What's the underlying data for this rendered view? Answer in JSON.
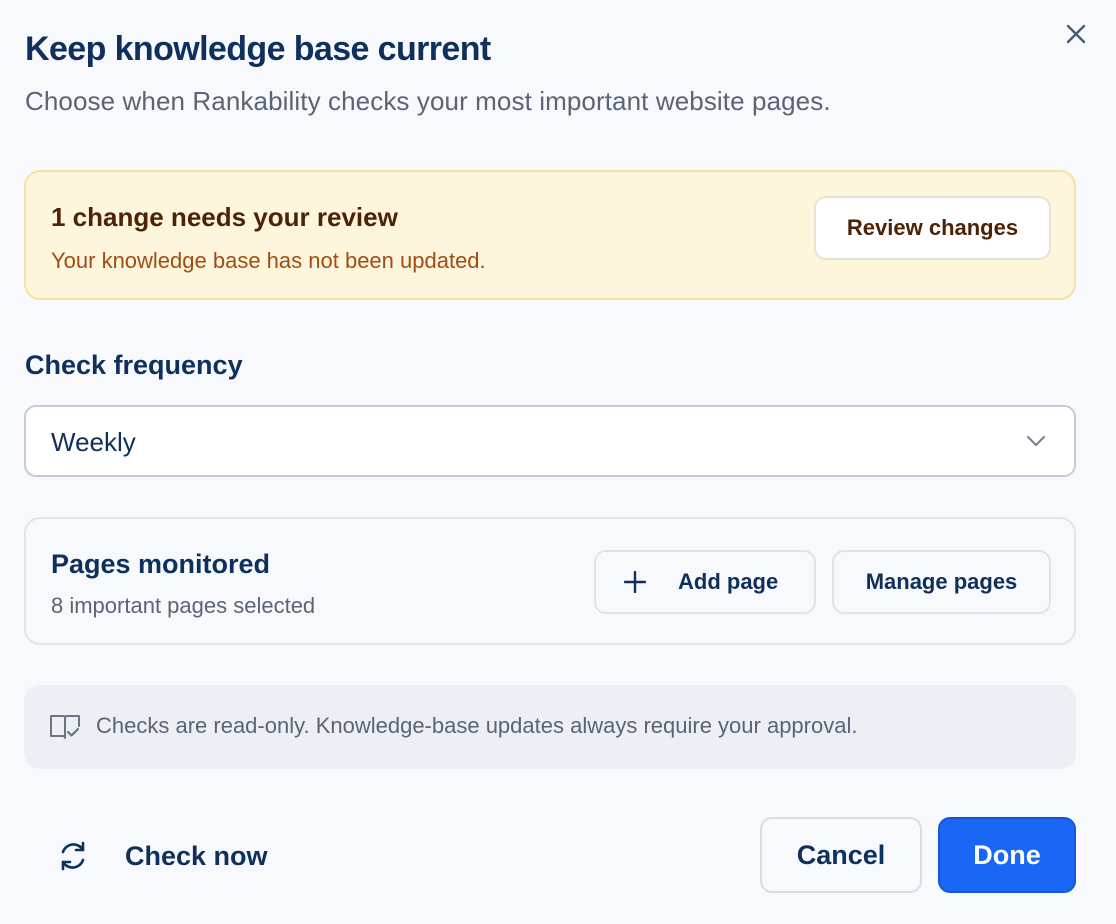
{
  "dialog": {
    "title": "Keep knowledge base current",
    "subtitle": "Choose when Rankability checks your most important website pages.",
    "close_icon": "close-icon"
  },
  "alert": {
    "title": "1 change needs your review",
    "text": "Your knowledge base has not been updated.",
    "review_label": "Review changes",
    "bg_color": "#fdf6dc",
    "text_color": "#a14d14"
  },
  "frequency": {
    "label": "Check frequency",
    "selected": "Weekly",
    "icon": "chevron-down-icon"
  },
  "pages": {
    "title": "Pages monitored",
    "subtitle": "8 important pages selected",
    "add_label": "Add page",
    "add_icon": "plus-icon",
    "manage_label": "Manage pages"
  },
  "info": {
    "icon": "book-check-icon",
    "text": "Checks are read-only. Knowledge-base updates always require your approval."
  },
  "footer": {
    "check_now_label": "Check now",
    "check_now_icon": "refresh-icon",
    "cancel_label": "Cancel",
    "done_label": "Done",
    "primary_color": "#1a66f5"
  }
}
